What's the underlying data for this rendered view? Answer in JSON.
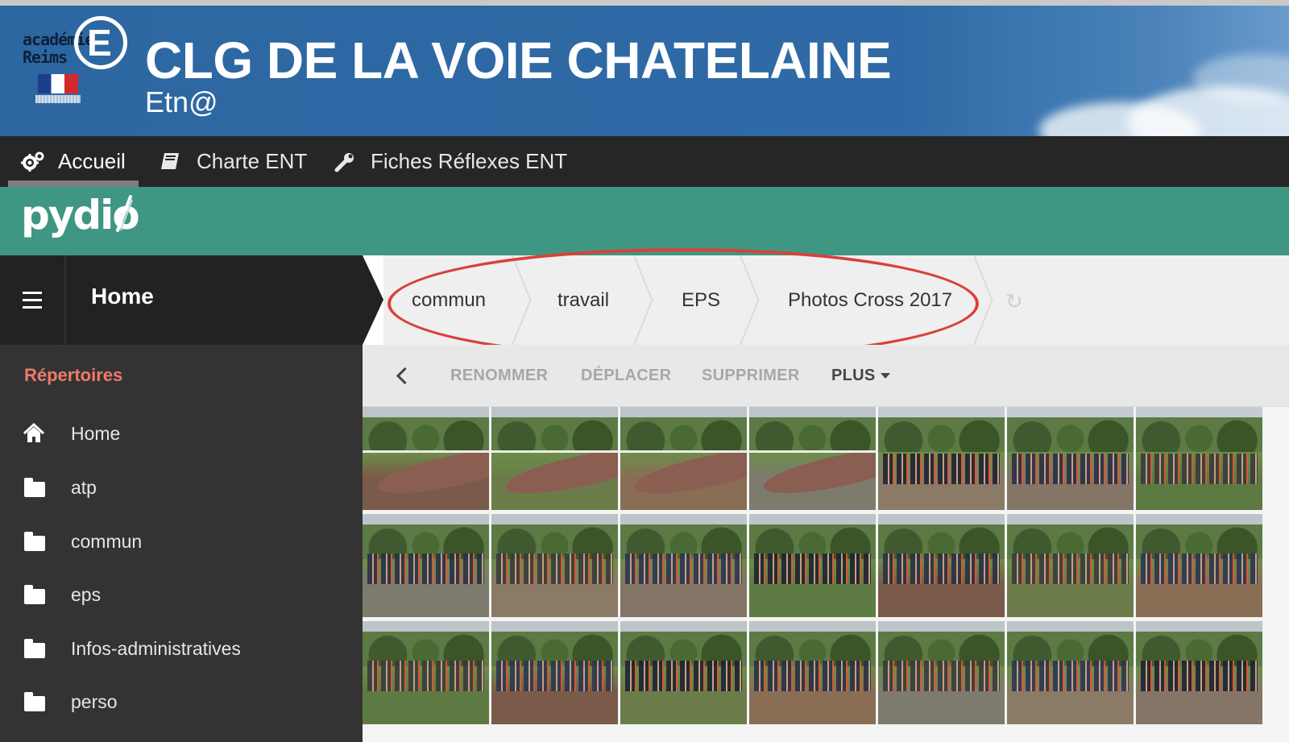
{
  "header": {
    "logo_text": "académie Reims",
    "title": "CLG DE LA VOIE CHATELAINE",
    "subtitle": "Etn@"
  },
  "nav": {
    "items": [
      {
        "label": "Accueil",
        "icon": "gears-icon",
        "active": true
      },
      {
        "label": "Charte ENT",
        "icon": "book-icon",
        "active": false
      },
      {
        "label": "Fiches Réflexes ENT",
        "icon": "wrench-icon",
        "active": false
      }
    ]
  },
  "app": {
    "logo": "pydio"
  },
  "sidebar": {
    "title": "Home",
    "section_label": "Répertoires",
    "items": [
      {
        "label": "Home",
        "icon": "home-icon"
      },
      {
        "label": "atp",
        "icon": "folder-icon"
      },
      {
        "label": "commun",
        "icon": "folder-icon"
      },
      {
        "label": "eps",
        "icon": "folder-icon"
      },
      {
        "label": "Infos-administratives",
        "icon": "folder-icon"
      },
      {
        "label": "perso",
        "icon": "folder-icon"
      }
    ]
  },
  "breadcrumb": {
    "items": [
      "commun",
      "travail",
      "EPS",
      "Photos Cross 2017"
    ],
    "annotation_color": "#d8413a"
  },
  "toolbar": {
    "rename": "RENOMMER",
    "move": "DÉPLACER",
    "delete": "SUPPRIMER",
    "more": "PLUS"
  },
  "colors": {
    "banner": "#2d67a2",
    "navbar": "#262626",
    "pydio_bar": "#3f9682",
    "sidebar": "#333333",
    "section_label": "#f0796a"
  }
}
